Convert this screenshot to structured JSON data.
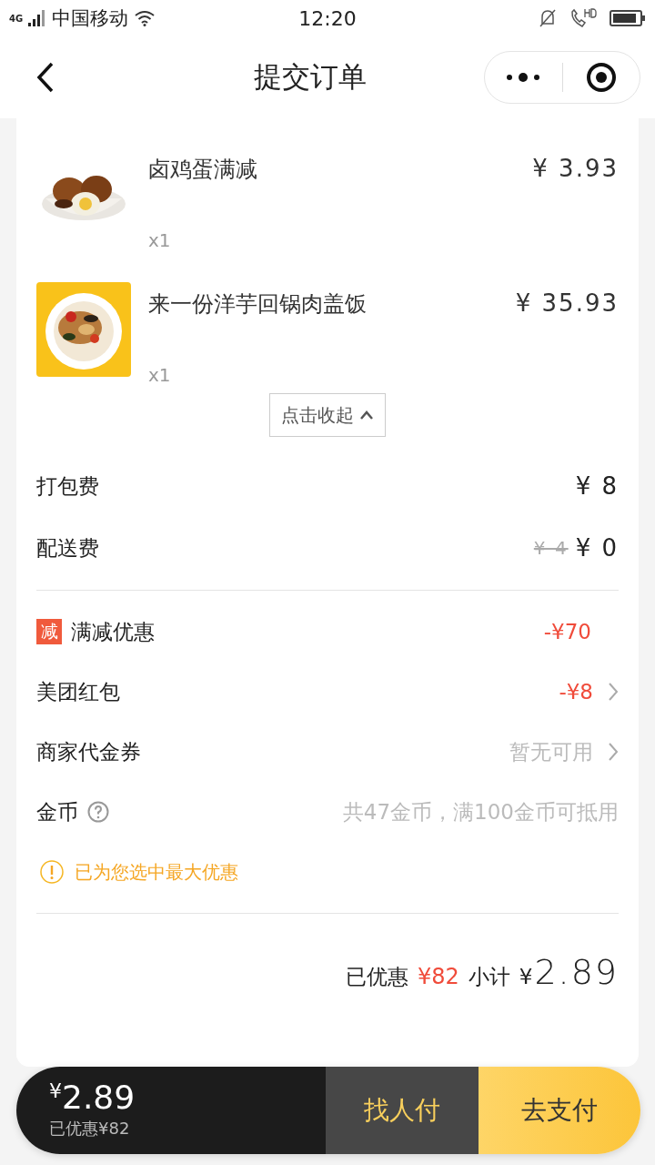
{
  "status_bar": {
    "network": "4G",
    "carrier": "中国移动",
    "time": "12:20"
  },
  "nav_bar": {
    "title": "提交订单"
  },
  "items": [
    {
      "name": "卤鸡蛋满减",
      "price": "¥ 3.93",
      "quantity": "x1"
    },
    {
      "name": "来一份洋芋回锅肉盖饭",
      "price": "¥ 35.93",
      "quantity": "x1"
    }
  ],
  "collapse_button": {
    "label": "点击收起",
    "expanded": true
  },
  "fees": [
    {
      "label": "打包费",
      "price": "¥ 8"
    },
    {
      "label": "配送费",
      "original_price": "¥ 4",
      "price": "¥ 0"
    }
  ],
  "discounts": [
    {
      "kind": "badge",
      "badge": "减",
      "label": "满减优惠",
      "value": "-¥70",
      "highlight": true,
      "chevron": false
    },
    {
      "kind": "plain",
      "label": "美团红包",
      "value": "-¥8",
      "highlight": true,
      "chevron": true
    },
    {
      "kind": "plain",
      "label": "商家代金券",
      "value": "暂无可用",
      "highlight": false,
      "chevron": true
    },
    {
      "kind": "help",
      "label": "金币",
      "value": "共47金币，满100金币可抵用",
      "highlight": false,
      "chevron": false
    }
  ],
  "notice": "已为您选中最大优惠",
  "summary": {
    "saved_label": "已优惠",
    "saved": "¥82",
    "subtotal_label": "小计",
    "currency": "¥",
    "subtotal": "2.89"
  },
  "pay_bar": {
    "currency": "¥",
    "total": "2.89",
    "saved": "已优惠¥82",
    "buttons": [
      {
        "kind": "secondary",
        "label": "找人付"
      },
      {
        "kind": "primary",
        "label": "去支付"
      }
    ]
  }
}
